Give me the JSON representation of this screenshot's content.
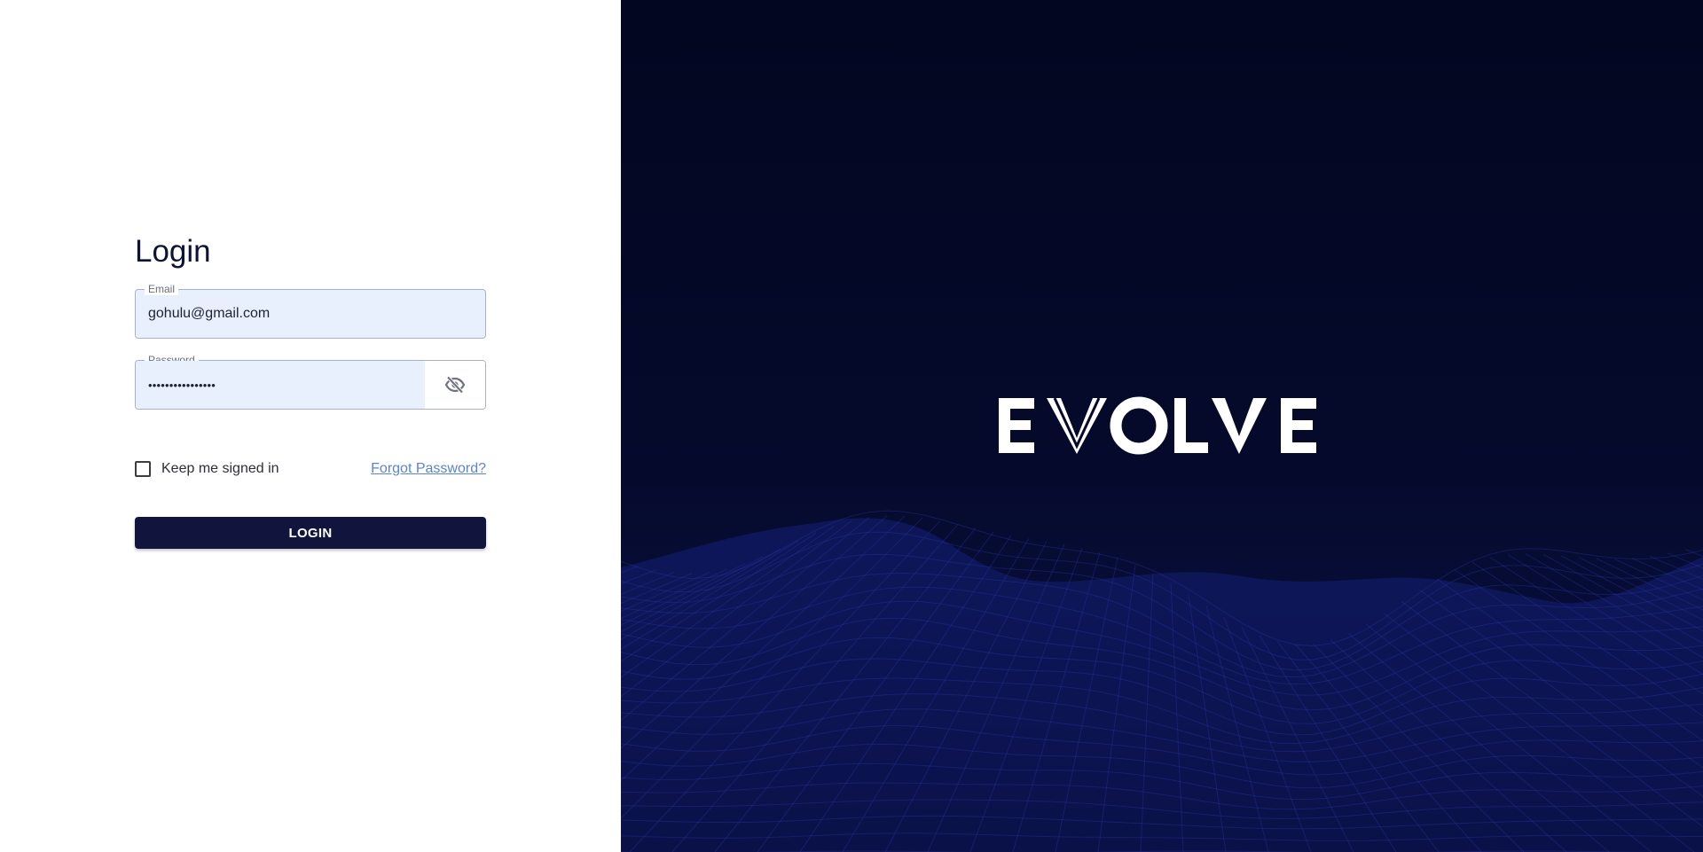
{
  "login": {
    "title": "Login",
    "email_label": "Email",
    "email_value": "gohulu@gmail.com",
    "password_label": "Password",
    "password_value": "••••••••••••••••",
    "toggle_icon": "eye-off-icon",
    "keep_signed_in_label": "Keep me signed in",
    "keep_signed_in_checked": false,
    "forgot_password_label": "Forgot Password?",
    "login_button_label": "LOGIN"
  },
  "brand": {
    "logo_text": "EVOLVE"
  },
  "colors": {
    "primary": "#11153d",
    "link": "#5b84d6",
    "autofill_bg": "#e8f0fe",
    "brand_bg": "#030620",
    "wave": "#1a2680"
  }
}
